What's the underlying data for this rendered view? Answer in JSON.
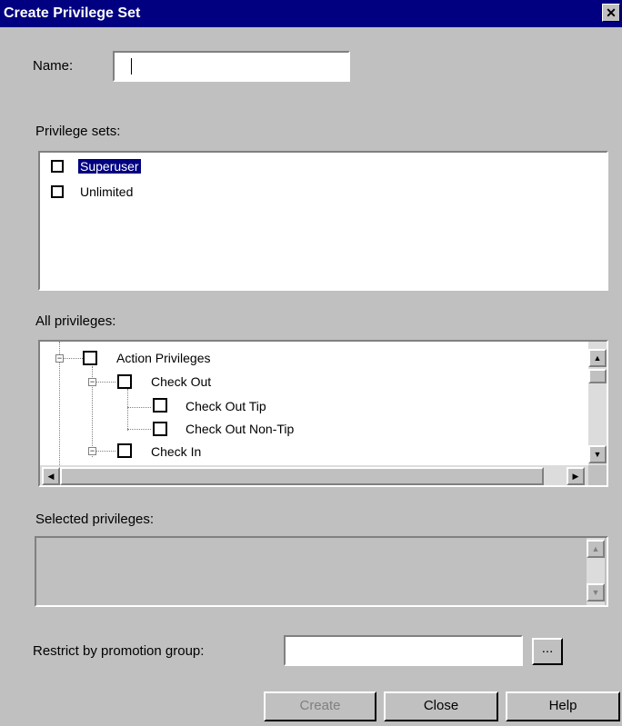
{
  "window": {
    "title": "Create Privilege Set"
  },
  "name_field": {
    "label": "Name:",
    "value": ""
  },
  "privilege_sets": {
    "label": "Privilege sets:",
    "items": [
      {
        "label": "Superuser",
        "selected": true
      },
      {
        "label": "Unlimited",
        "selected": false
      }
    ]
  },
  "all_privileges": {
    "label": "All privileges:",
    "tree": [
      {
        "label": "Action Privileges"
      },
      {
        "label": "Check Out"
      },
      {
        "label": "Check Out Tip"
      },
      {
        "label": "Check Out Non-Tip"
      },
      {
        "label": "Check In"
      }
    ]
  },
  "selected_privileges": {
    "label": "Selected privileges:"
  },
  "promotion_group": {
    "label": "Restrict by promotion group:",
    "value": "",
    "browse_label": "..."
  },
  "buttons": {
    "create": "Create",
    "close": "Close",
    "help": "Help"
  },
  "colors": {
    "face": "#c0c0c0",
    "title_bar": "#000080",
    "selection": "#000080"
  }
}
